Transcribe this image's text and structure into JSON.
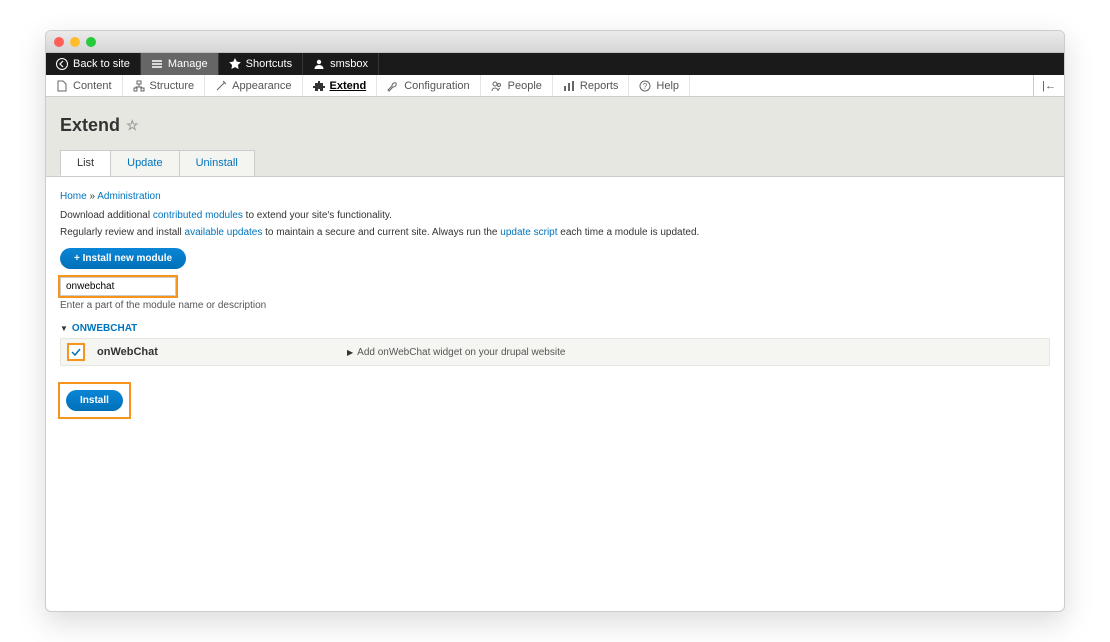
{
  "titlebar": {
    "title": ""
  },
  "admin_toolbar": {
    "back_label": "Back to site",
    "manage_label": "Manage",
    "shortcuts_label": "Shortcuts",
    "user_label": "smsbox"
  },
  "menu": {
    "items": [
      {
        "label": "Content"
      },
      {
        "label": "Structure"
      },
      {
        "label": "Appearance"
      },
      {
        "label": "Extend"
      },
      {
        "label": "Configuration"
      },
      {
        "label": "People"
      },
      {
        "label": "Reports"
      },
      {
        "label": "Help"
      }
    ],
    "right_label": "|←"
  },
  "page": {
    "title": "Extend",
    "tabs": [
      {
        "label": "List",
        "active": true
      },
      {
        "label": "Update",
        "active": false
      },
      {
        "label": "Uninstall",
        "active": false
      }
    ],
    "breadcrumb": {
      "home": "Home",
      "sep": " » ",
      "admin": "Administration"
    },
    "desc1_prefix": "Download additional ",
    "desc1_link": "contributed modules",
    "desc1_suffix": " to extend your site's functionality.",
    "desc2_prefix": "Regularly review and install ",
    "desc2_link1": "available updates",
    "desc2_mid": " to maintain a secure and current site. Always run the ",
    "desc2_link2": "update script",
    "desc2_suffix": " each time a module is updated.",
    "install_new_label": "+ Install new module",
    "search_value": "onwebchat",
    "search_help": "Enter a part of the module name or description",
    "group_header": "ONWEBCHAT",
    "module": {
      "name": "onWebChat",
      "desc": "Add onWebChat widget on your drupal website",
      "checked": true
    },
    "install_label": "Install"
  }
}
